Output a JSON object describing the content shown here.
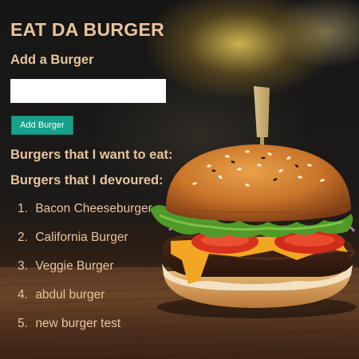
{
  "page": {
    "title": "EAT DA BURGER"
  },
  "add_section": {
    "heading": "Add a Burger",
    "input_value": "",
    "input_placeholder": "",
    "button_label": "Add Burger"
  },
  "want_section": {
    "heading": "Burgers that I want to eat:",
    "items": []
  },
  "devoured_section": {
    "heading": "Burgers that I devoured:",
    "items": [
      {
        "number": "1.",
        "name": "Bacon Cheeseburger"
      },
      {
        "number": "2.",
        "name": "California Burger"
      },
      {
        "number": "3.",
        "name": "Veggie Burger"
      },
      {
        "number": "4.",
        "name": "abdul burger"
      },
      {
        "number": "5.",
        "name": "new burger test"
      }
    ]
  },
  "colors": {
    "text_accent": "#e8c39e",
    "button_bg": "#17a08c",
    "input_bg": "#ffffff"
  }
}
